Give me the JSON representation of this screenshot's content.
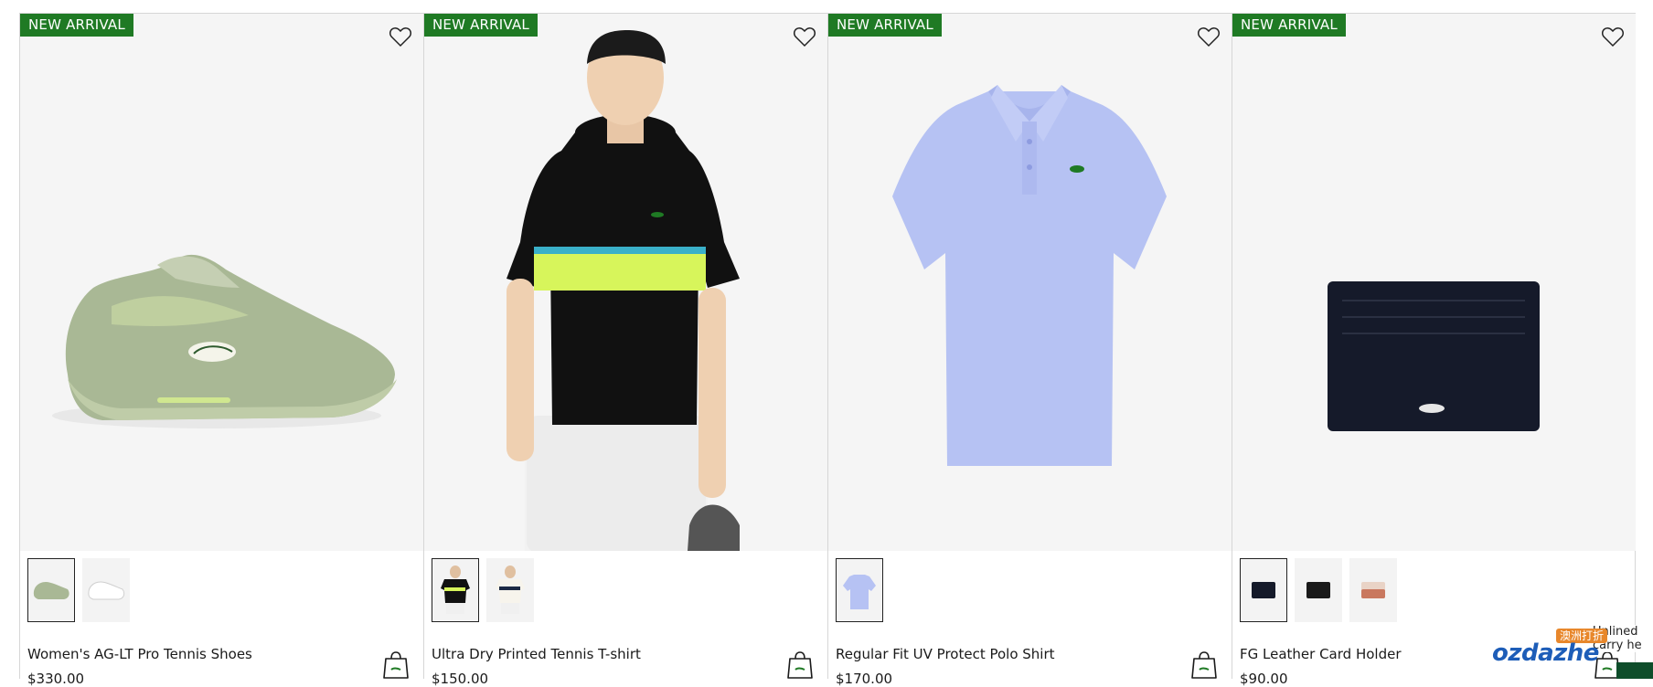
{
  "colors": {
    "badge": "#1f7a24",
    "border": "#d6d6d6",
    "media_bg": "#f5f5f5"
  },
  "products": [
    {
      "badge": "NEW ARRIVAL",
      "name": "Women's AG-LT Pro Tennis Shoes",
      "price": "$330.00",
      "swatches": [
        "sage green",
        "white"
      ]
    },
    {
      "badge": "NEW ARRIVAL",
      "name": "Ultra Dry Printed Tennis T-shirt",
      "price": "$150.00",
      "swatches": [
        "black",
        "white"
      ]
    },
    {
      "badge": "NEW ARRIVAL",
      "name": "Regular Fit UV Protect Polo Shirt",
      "price": "$170.00",
      "swatches": [
        "light blue"
      ]
    },
    {
      "badge": "NEW ARRIVAL",
      "name": "FG Leather Card Holder",
      "price": "$90.00",
      "swatches": [
        "navy",
        "black",
        "tan"
      ]
    }
  ],
  "icons": {
    "wishlist": "heart-outline-icon",
    "bag": "shopping-bag-icon"
  },
  "watermark": {
    "logo": "ozdazhe",
    "tag": "澳洲打折",
    "overlay_text": "Unlined carry he"
  }
}
